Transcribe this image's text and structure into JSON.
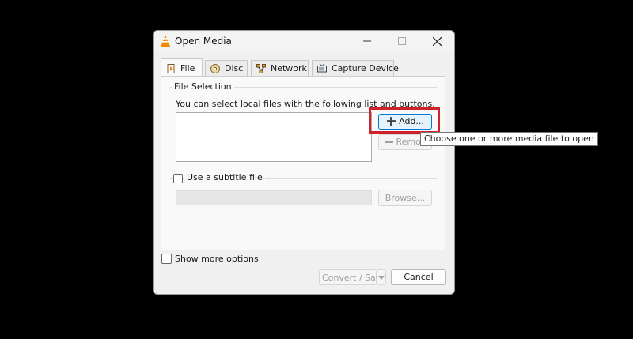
{
  "window": {
    "title": "Open Media",
    "icon": "vlc-cone-icon"
  },
  "tabs": [
    {
      "label": "File",
      "icon": "file-icon",
      "active": true
    },
    {
      "label": "Disc",
      "icon": "disc-icon",
      "active": false
    },
    {
      "label": "Network",
      "icon": "network-icon",
      "active": false
    },
    {
      "label": "Capture Device",
      "icon": "capture-device-icon",
      "active": false
    }
  ],
  "file_selection": {
    "group_title": "File Selection",
    "description": "You can select local files with the following list and buttons.",
    "add_label": "Add...",
    "remove_label": "Remove"
  },
  "subtitle": {
    "checkbox_label": "Use a subtitle file",
    "checked": false,
    "browse_label": "Browse..."
  },
  "tooltip": "Choose one or more media file to open",
  "footer": {
    "show_more_label": "Show more options",
    "show_more_checked": false,
    "convert_label": "Convert / Save",
    "cancel_label": "Cancel"
  },
  "colors": {
    "highlight": "#d0202a",
    "vlc_orange": "#f08a00",
    "hover_blue": "#0078d4"
  }
}
